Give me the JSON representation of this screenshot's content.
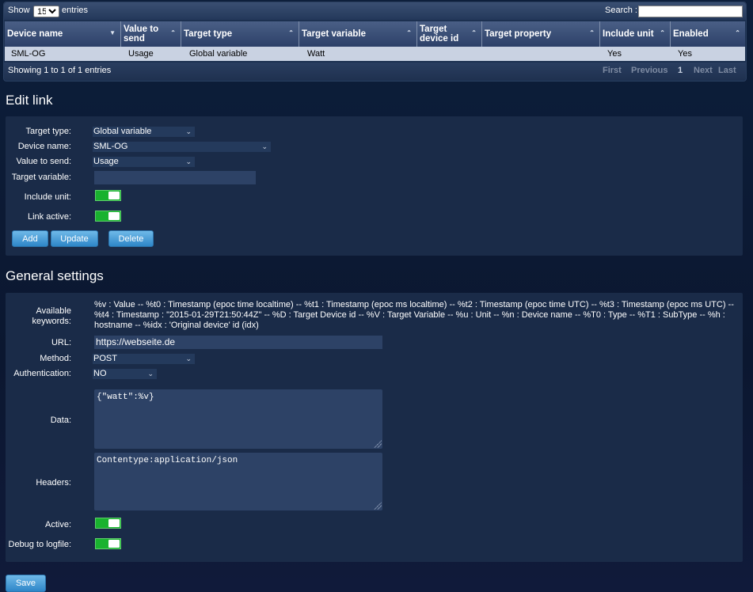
{
  "table": {
    "show_label": "Show",
    "entries_value": "15",
    "entries_label": "entries",
    "search_label": "Search :",
    "columns": [
      "Device name",
      "Value to send",
      "Target type",
      "Target variable",
      "Target device id",
      "Target property",
      "Include unit",
      "Enabled"
    ],
    "rows": [
      [
        "SML-OG",
        "Usage",
        "Global variable",
        "Watt",
        "",
        "",
        "Yes",
        "Yes"
      ]
    ],
    "info": "Showing 1 to 1 of 1 entries",
    "pagination": {
      "first": "First",
      "previous": "Previous",
      "page": "1",
      "next": "Next",
      "last": "Last"
    }
  },
  "edit_link": {
    "heading": "Edit link",
    "target_type_label": "Target type:",
    "target_type_value": "Global variable",
    "device_name_label": "Device name:",
    "device_name_value": "SML-OG",
    "value_to_send_label": "Value to send:",
    "value_to_send_value": "Usage",
    "target_variable_label": "Target variable:",
    "target_variable_value": "",
    "include_unit_label": "Include unit:",
    "include_unit_on": true,
    "link_active_label": "Link active:",
    "link_active_on": true,
    "add_label": "Add",
    "update_label": "Update",
    "delete_label": "Delete"
  },
  "general": {
    "heading": "General settings",
    "keywords_label": "Available keywords:",
    "keywords_text": "%v : Value -- %t0 : Timestamp (epoc time localtime) -- %t1 : Timestamp (epoc ms localtime) -- %t2 : Timestamp (epoc time UTC) -- %t3 : Timestamp (epoc ms UTC) -- %t4 : Timestamp : \"2015-01-29T21:50:44Z\" -- %D : Target Device id -- %V : Target Variable -- %u : Unit -- %n : Device name -- %T0 : Type -- %T1 : SubType -- %h : hostname -- %idx : 'Original device' id (idx)",
    "url_label": "URL:",
    "url_value": "https://webseite.de",
    "method_label": "Method:",
    "method_value": "POST",
    "auth_label": "Authentication:",
    "auth_value": "NO",
    "data_label": "Data:",
    "data_value": "{\"watt\":%v}",
    "headers_label": "Headers:",
    "headers_value": "Contentype:application/json",
    "active_label": "Active:",
    "active_on": true,
    "debug_label": "Debug to logfile:",
    "debug_on": true,
    "save_label": "Save"
  },
  "colors": {
    "accent": "#2e86c8",
    "toggle_on": "#19b22f",
    "panel": "#1a2b48"
  }
}
